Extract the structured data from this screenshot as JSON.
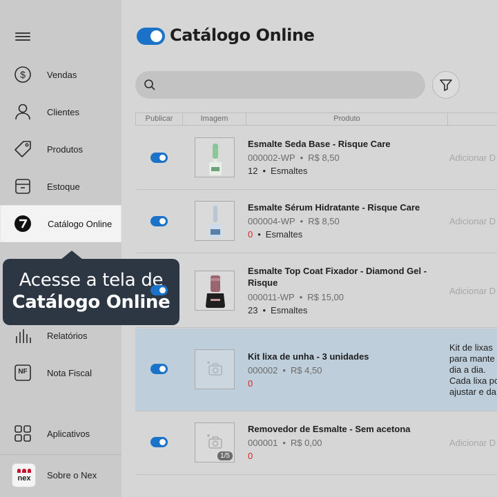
{
  "sidebar": {
    "items": [
      {
        "label": "Vendas",
        "icon": "dollar-circle-icon"
      },
      {
        "label": "Clientes",
        "icon": "user-icon"
      },
      {
        "label": "Produtos",
        "icon": "tag-icon"
      },
      {
        "label": "Estoque",
        "icon": "box-icon"
      },
      {
        "label": "Catálogo Online",
        "icon": "catalog-icon"
      },
      {
        "label": "Relatórios",
        "icon": "bar-chart-icon"
      },
      {
        "label": "Nota Fiscal",
        "icon": "nf-icon"
      },
      {
        "label": "Aplicativos",
        "icon": "apps-grid-icon"
      },
      {
        "label": "Sobre o Nex",
        "icon": "nex-logo"
      }
    ],
    "logo_text": "nex",
    "nf_text": "NF"
  },
  "callout": {
    "line1": "Acesse a tela de",
    "line2": "Catálogo Online"
  },
  "header": {
    "title": "Catálogo Online"
  },
  "search": {
    "placeholder": "",
    "value": ""
  },
  "table": {
    "columns": [
      "Publicar",
      "Imagem",
      "Produto",
      ""
    ],
    "rows": [
      {
        "name": "Esmalte Seda Base - Risque Care",
        "sku": "000002-WP",
        "price": "R$ 8,50",
        "stock": "12",
        "category": "Esmaltes",
        "extra": "Adicionar D",
        "image": "green-polish"
      },
      {
        "name": "Esmalte Sérum Hidratante - Risque Care",
        "sku": "000004-WP",
        "price": "R$ 8,50",
        "stock": "0",
        "category": "Esmaltes",
        "extra": "Adicionar D",
        "image": "clear-polish"
      },
      {
        "name": "Esmalte Top Coat Fixador - Diamond Gel - Risque",
        "sku": "000011-WP",
        "price": "R$ 15,00",
        "stock": "23",
        "category": "Esmaltes",
        "extra": "Adicionar D",
        "image": "pink-polish"
      },
      {
        "name": "Kit lixa de unha - 3 unidades",
        "sku": "000002",
        "price": "R$ 4,50",
        "stock": "0",
        "category": "",
        "description": "Kit de lixas\npara mante\ndia a dia.\nCada lixa po\najustar e da",
        "image": "placeholder"
      },
      {
        "name": "Removedor de Esmalte - Sem acetona",
        "sku": "000001",
        "price": "R$ 0,00",
        "stock": "0",
        "category": "",
        "extra": "Adicionar D",
        "image": "placeholder",
        "image_count": "1/5"
      }
    ]
  },
  "colors": {
    "accent": "#1a73c8",
    "callout_bg": "#2c3743",
    "highlight_row": "#bfcedb",
    "zero_stock": "#e02020"
  }
}
